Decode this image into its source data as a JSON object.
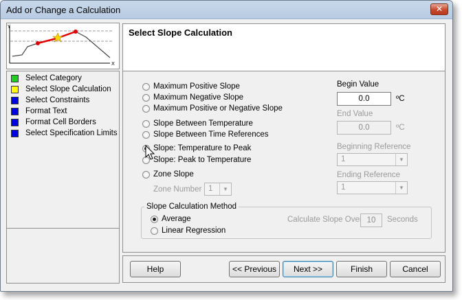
{
  "window": {
    "title": "Add or Change a Calculation",
    "close_glyph": "✕"
  },
  "thumbnail": {
    "y_axis": "Y",
    "x_axis": "X",
    "line_color": "#e00000",
    "star_color": "#ffd700"
  },
  "steps": [
    {
      "label": "Select Category",
      "color": "#22cc22"
    },
    {
      "label": "Select Slope Calculation",
      "color": "#ffff00"
    },
    {
      "label": "Select Constraints",
      "color": "#0000ee"
    },
    {
      "label": "Format Text",
      "color": "#0000ee"
    },
    {
      "label": "Format Cell Borders",
      "color": "#0000ee"
    },
    {
      "label": "Select Specification Limits",
      "color": "#0000ee"
    }
  ],
  "header": {
    "title": "Select Slope Calculation"
  },
  "slope_options": {
    "max_positive": "Maximum Positive Slope",
    "max_negative": "Maximum Negative Slope",
    "max_pos_or_neg": "Maximum Positive or Negative Slope",
    "between_temp": "Slope Between Temperature",
    "between_time_refs": "Slope Between Time References",
    "temp_to_peak": "Slope: Temperature to Peak",
    "peak_to_temp": "Slope: Peak to Temperature",
    "zone": "Zone Slope",
    "selected": "Slope: Temperature to Peak"
  },
  "zone_number": {
    "label": "Zone Number",
    "value": "1"
  },
  "begin_value": {
    "label": "Begin Value",
    "value": "0.0",
    "unit": "ºC"
  },
  "end_value": {
    "label": "End Value",
    "value": "0.0",
    "unit": "ºC"
  },
  "beginning_reference": {
    "label": "Beginning Reference",
    "value": "1"
  },
  "ending_reference": {
    "label": "Ending Reference",
    "value": "1"
  },
  "method": {
    "legend": "Slope Calculation Method",
    "average": "Average",
    "linear_regression": "Linear Regression",
    "selected": "Average",
    "calc_over_label": "Calculate Slope Over",
    "calc_over_value": "10",
    "calc_over_unit": "Seconds"
  },
  "buttons": {
    "help": "Help",
    "previous": "<< Previous",
    "next": "Next >>",
    "finish": "Finish",
    "cancel": "Cancel"
  }
}
